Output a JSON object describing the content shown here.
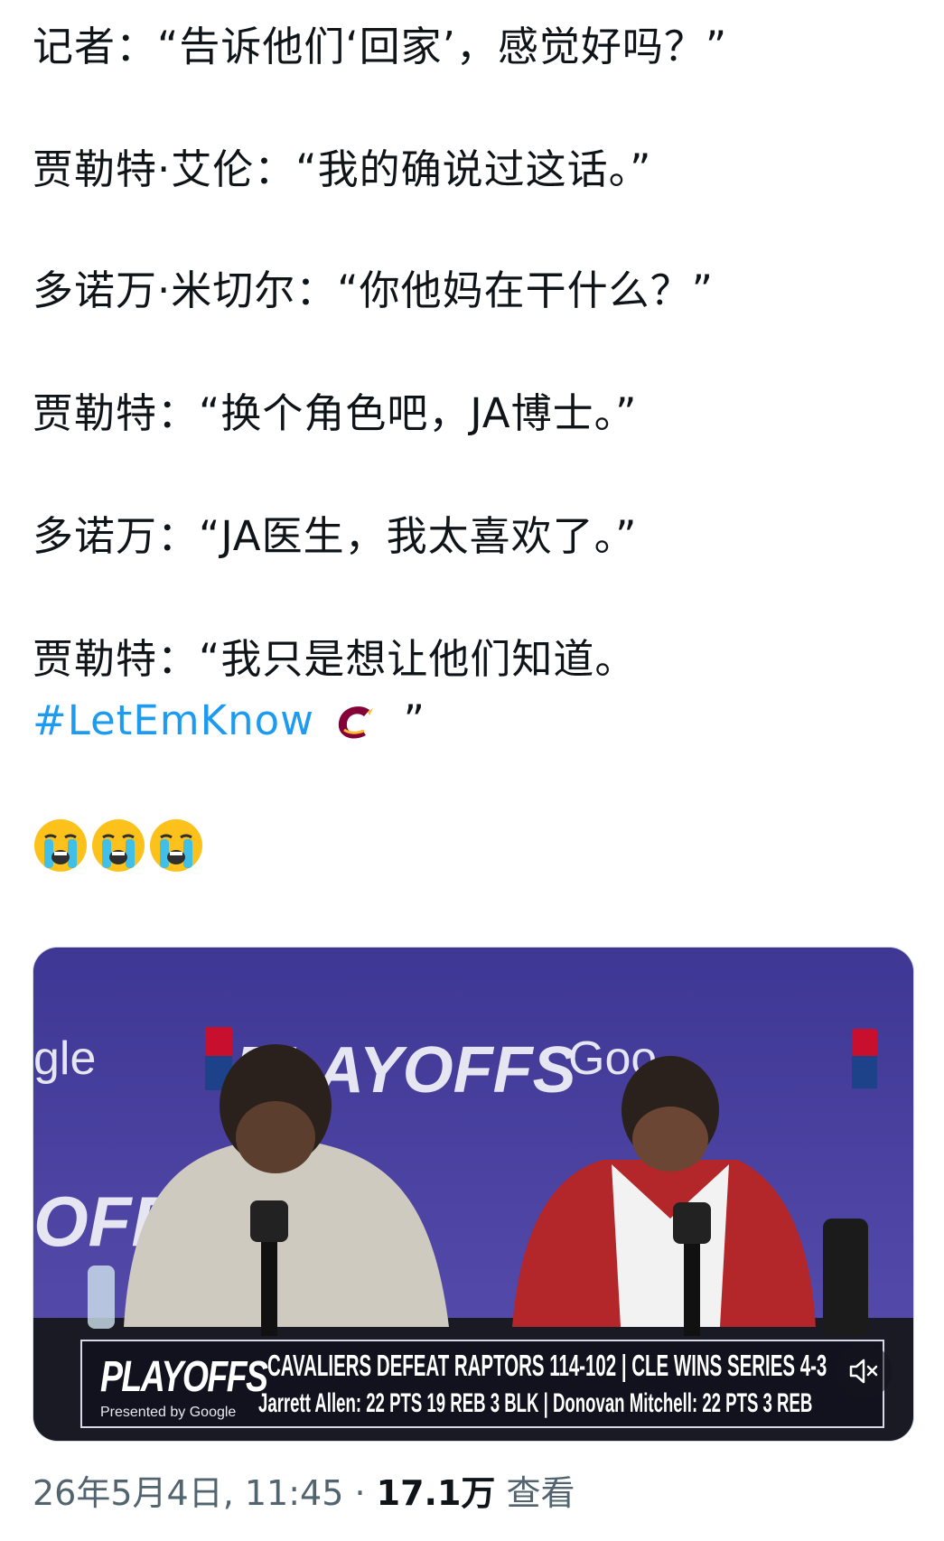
{
  "tweet": {
    "lines": [
      "记者：“告诉他们‘回家’，感觉好吗？”",
      "贾勒特·艾伦：“我的确说过这话。”",
      "多诺万·米切尔：“你他妈在干什么？”",
      "贾勒特：“换个角色吧，JA博士。”",
      "多诺万：“JA医生，我太喜欢了。”",
      "贾勒特：“我只是想让他们知道。"
    ],
    "hashtag": "#LetEmKnow",
    "hashtag_close": "”",
    "emojis": [
      "loudly-crying-face",
      "loudly-crying-face",
      "loudly-crying-face"
    ]
  },
  "media": {
    "backdrop_words": [
      "gle",
      "Goo",
      "OFFS",
      "PLAYOFFS"
    ],
    "banner": {
      "brand": "PLAYOFFS",
      "presented": "Presented by Google",
      "headline": "CAVALIERS DEFEAT RAPTORS 114-102 | CLE WINS SERIES 4-3",
      "stats": "Jarrett Allen: 22 PTS  19 REB  3 BLK | Donovan Mitchell:  22 PTS  3 REB"
    },
    "mute_icon": "speaker-muted-icon"
  },
  "footer": {
    "timestamp": "26年5月4日, 11:45",
    "separator": " · ",
    "views": "17.1万",
    "views_label": " 查看"
  },
  "colors": {
    "hashtag": "#1d9bf0",
    "muted_text": "#536471",
    "backdrop": "#4a3f9e"
  }
}
